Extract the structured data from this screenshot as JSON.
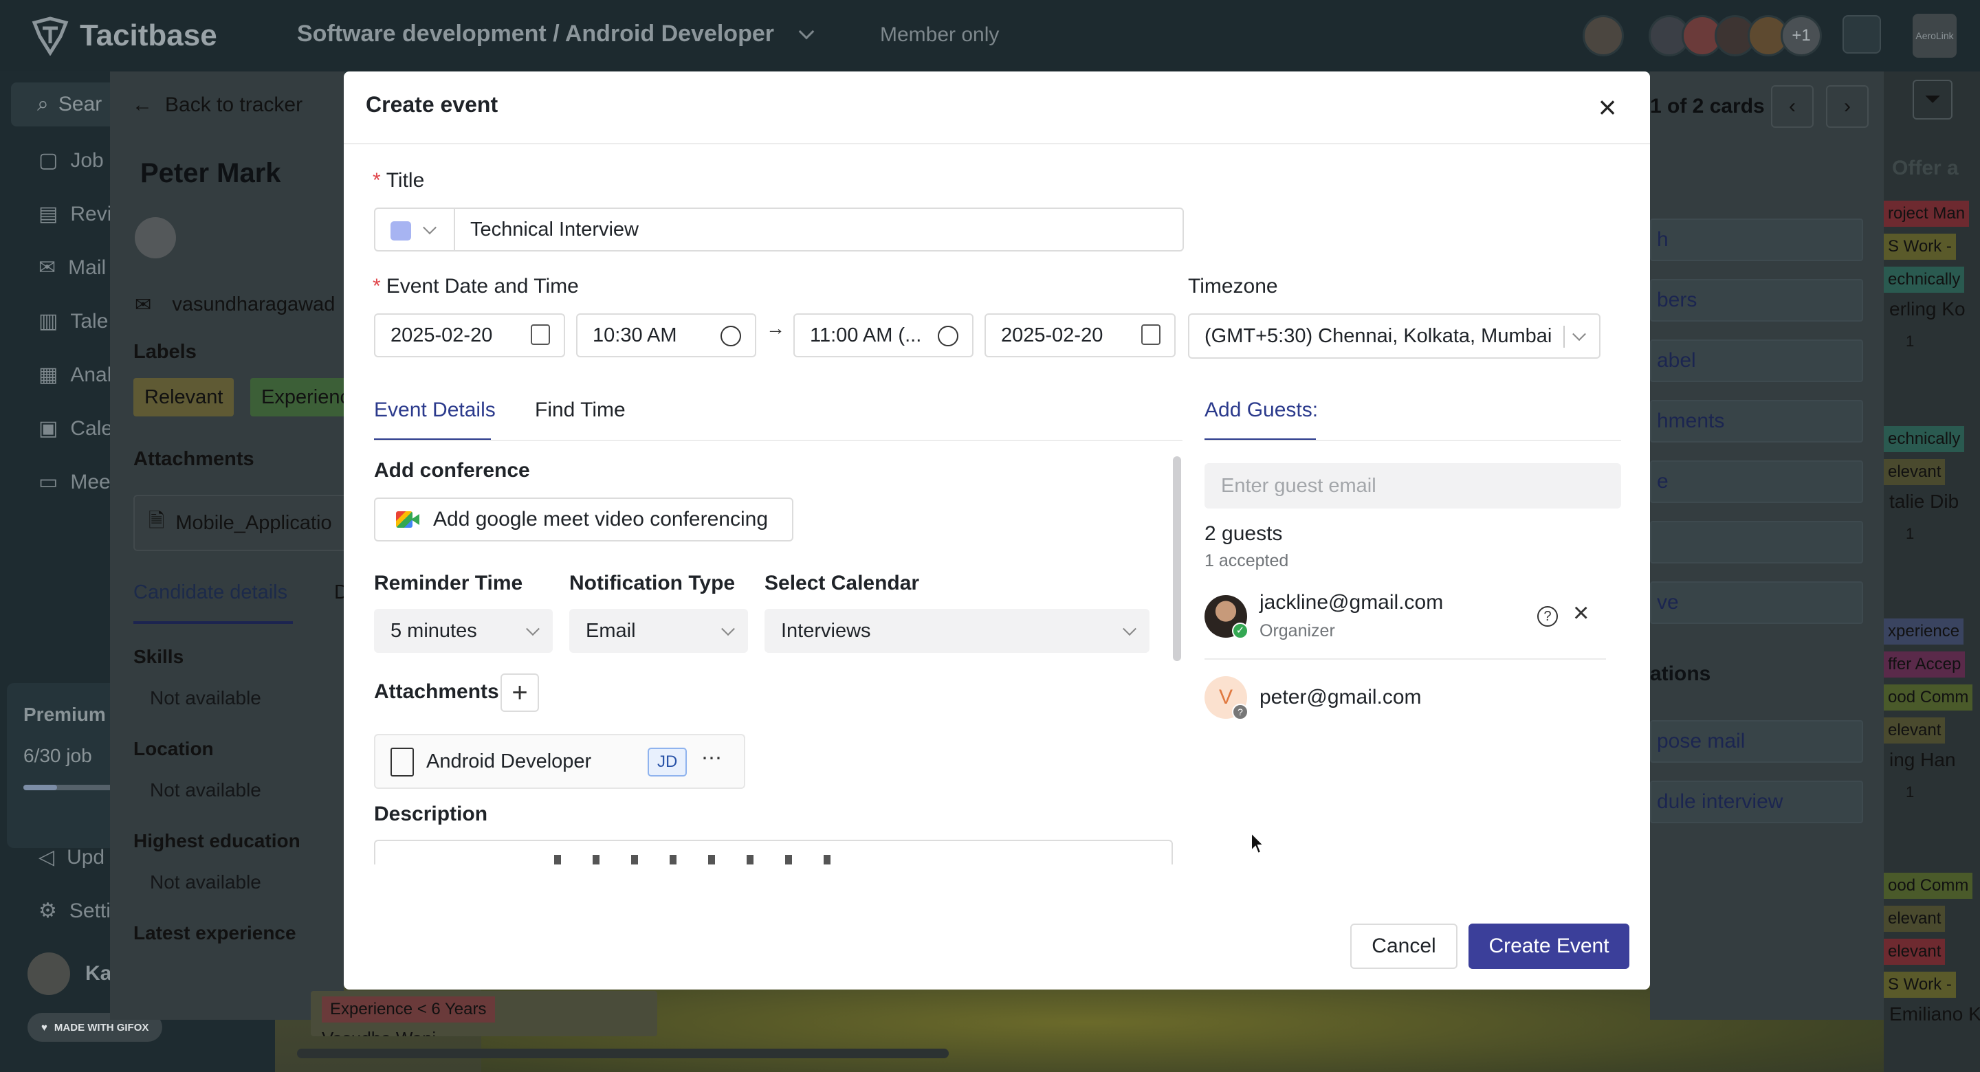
{
  "app": {
    "brand": "Tacitbase",
    "breadcrumb": "Software development / Android Developer",
    "visibility": "Member only",
    "avatar_extra": "+1",
    "org_label": "AeroLink"
  },
  "sidebar": {
    "search_label": "Sear",
    "items": [
      {
        "label": "Job",
        "icon": "jobs-icon"
      },
      {
        "label": "Revi",
        "icon": "review-icon"
      },
      {
        "label": "Mail",
        "icon": "mail-icon"
      },
      {
        "label": "Tale",
        "icon": "talent-icon"
      },
      {
        "label": "Anal",
        "icon": "analytics-icon"
      },
      {
        "label": "Cale",
        "icon": "calendar-icon"
      },
      {
        "label": "Mee",
        "icon": "meetings-icon"
      }
    ],
    "premium_label": "Premium",
    "premium_usage": "6/30 job",
    "premium_progress": 0.35,
    "update_label": "Upd",
    "settings_label": "Setti",
    "user_label": "Ka",
    "gifox_badge": "MADE WITH GIFOX"
  },
  "candidate": {
    "back_label": "Back to tracker",
    "name": "Peter Mark",
    "email": "vasundharagawad",
    "labels_heading": "Labels",
    "labels": [
      "Relevant",
      "Experienc"
    ],
    "attachments_heading": "Attachments",
    "attachment_name": "Mobile_Applicatio",
    "tab_active": "Candidate details",
    "tab_next": "D",
    "skills_heading": "Skills",
    "skills_value": "Not available",
    "location_heading": "Location",
    "location_value": "Not available",
    "education_heading": "Highest education",
    "education_value": "Not available",
    "experience_heading": "Latest experience"
  },
  "tracker": {
    "card_count": "1 of 2 cards",
    "column_title": "Offer a",
    "actions": [
      "h",
      "bers",
      "abel",
      "hments",
      "e",
      "",
      "ve"
    ],
    "section_title": "ations",
    "bottom_actions": [
      "pose mail",
      "dule interview"
    ],
    "board_tags": [
      "roject Man",
      "S Work -",
      "echnically",
      "erling Ko",
      "1",
      "echnically",
      "elevant",
      "talie Dib",
      "1",
      "xperience",
      "ffer Accep",
      "ood Comm",
      "elevant",
      "ing Han",
      "1",
      "ood Comm",
      "elevant",
      "elevant",
      "S Work -",
      "Emiliano K"
    ],
    "bottom_card_tag": "Experience < 6 Years",
    "bottom_card_text": "Vasudha Wanj"
  },
  "modal": {
    "title": "Create event",
    "title_label": "Title",
    "title_value": "Technical Interview",
    "event_color": "#a7b4f2",
    "datetime_label": "Event Date and Time",
    "start_date": "2025-02-20",
    "start_time": "10:30 AM",
    "end_time": "11:00 AM (...",
    "end_date": "2025-02-20",
    "arrow": "→",
    "timezone_label": "Timezone",
    "timezone_value": "(GMT+5:30) Chennai, Kolkata, Mumbai",
    "tabs": [
      "Event Details",
      "Find Time"
    ],
    "conference_label": "Add conference",
    "conference_button": "Add google meet video conferencing",
    "reminder_label": "Reminder Time",
    "reminder_value": "5 minutes",
    "notification_label": "Notification Type",
    "notification_value": "Email",
    "calendar_label": "Select Calendar",
    "calendar_value": "Interviews",
    "attachments_label": "Attachments",
    "attachment_name": "Android Developer",
    "attachment_tag": "JD",
    "description_label": "Description",
    "guests_tab": "Add Guests:",
    "guest_placeholder": "Enter guest email",
    "guest_count": "2 guests",
    "guest_accepted": "1 accepted",
    "guests": [
      {
        "email": "jackline@gmail.com",
        "role": "Organizer"
      },
      {
        "email": "peter@gmail.com",
        "initial": "V"
      }
    ],
    "cancel_label": "Cancel",
    "create_label": "Create Event"
  }
}
